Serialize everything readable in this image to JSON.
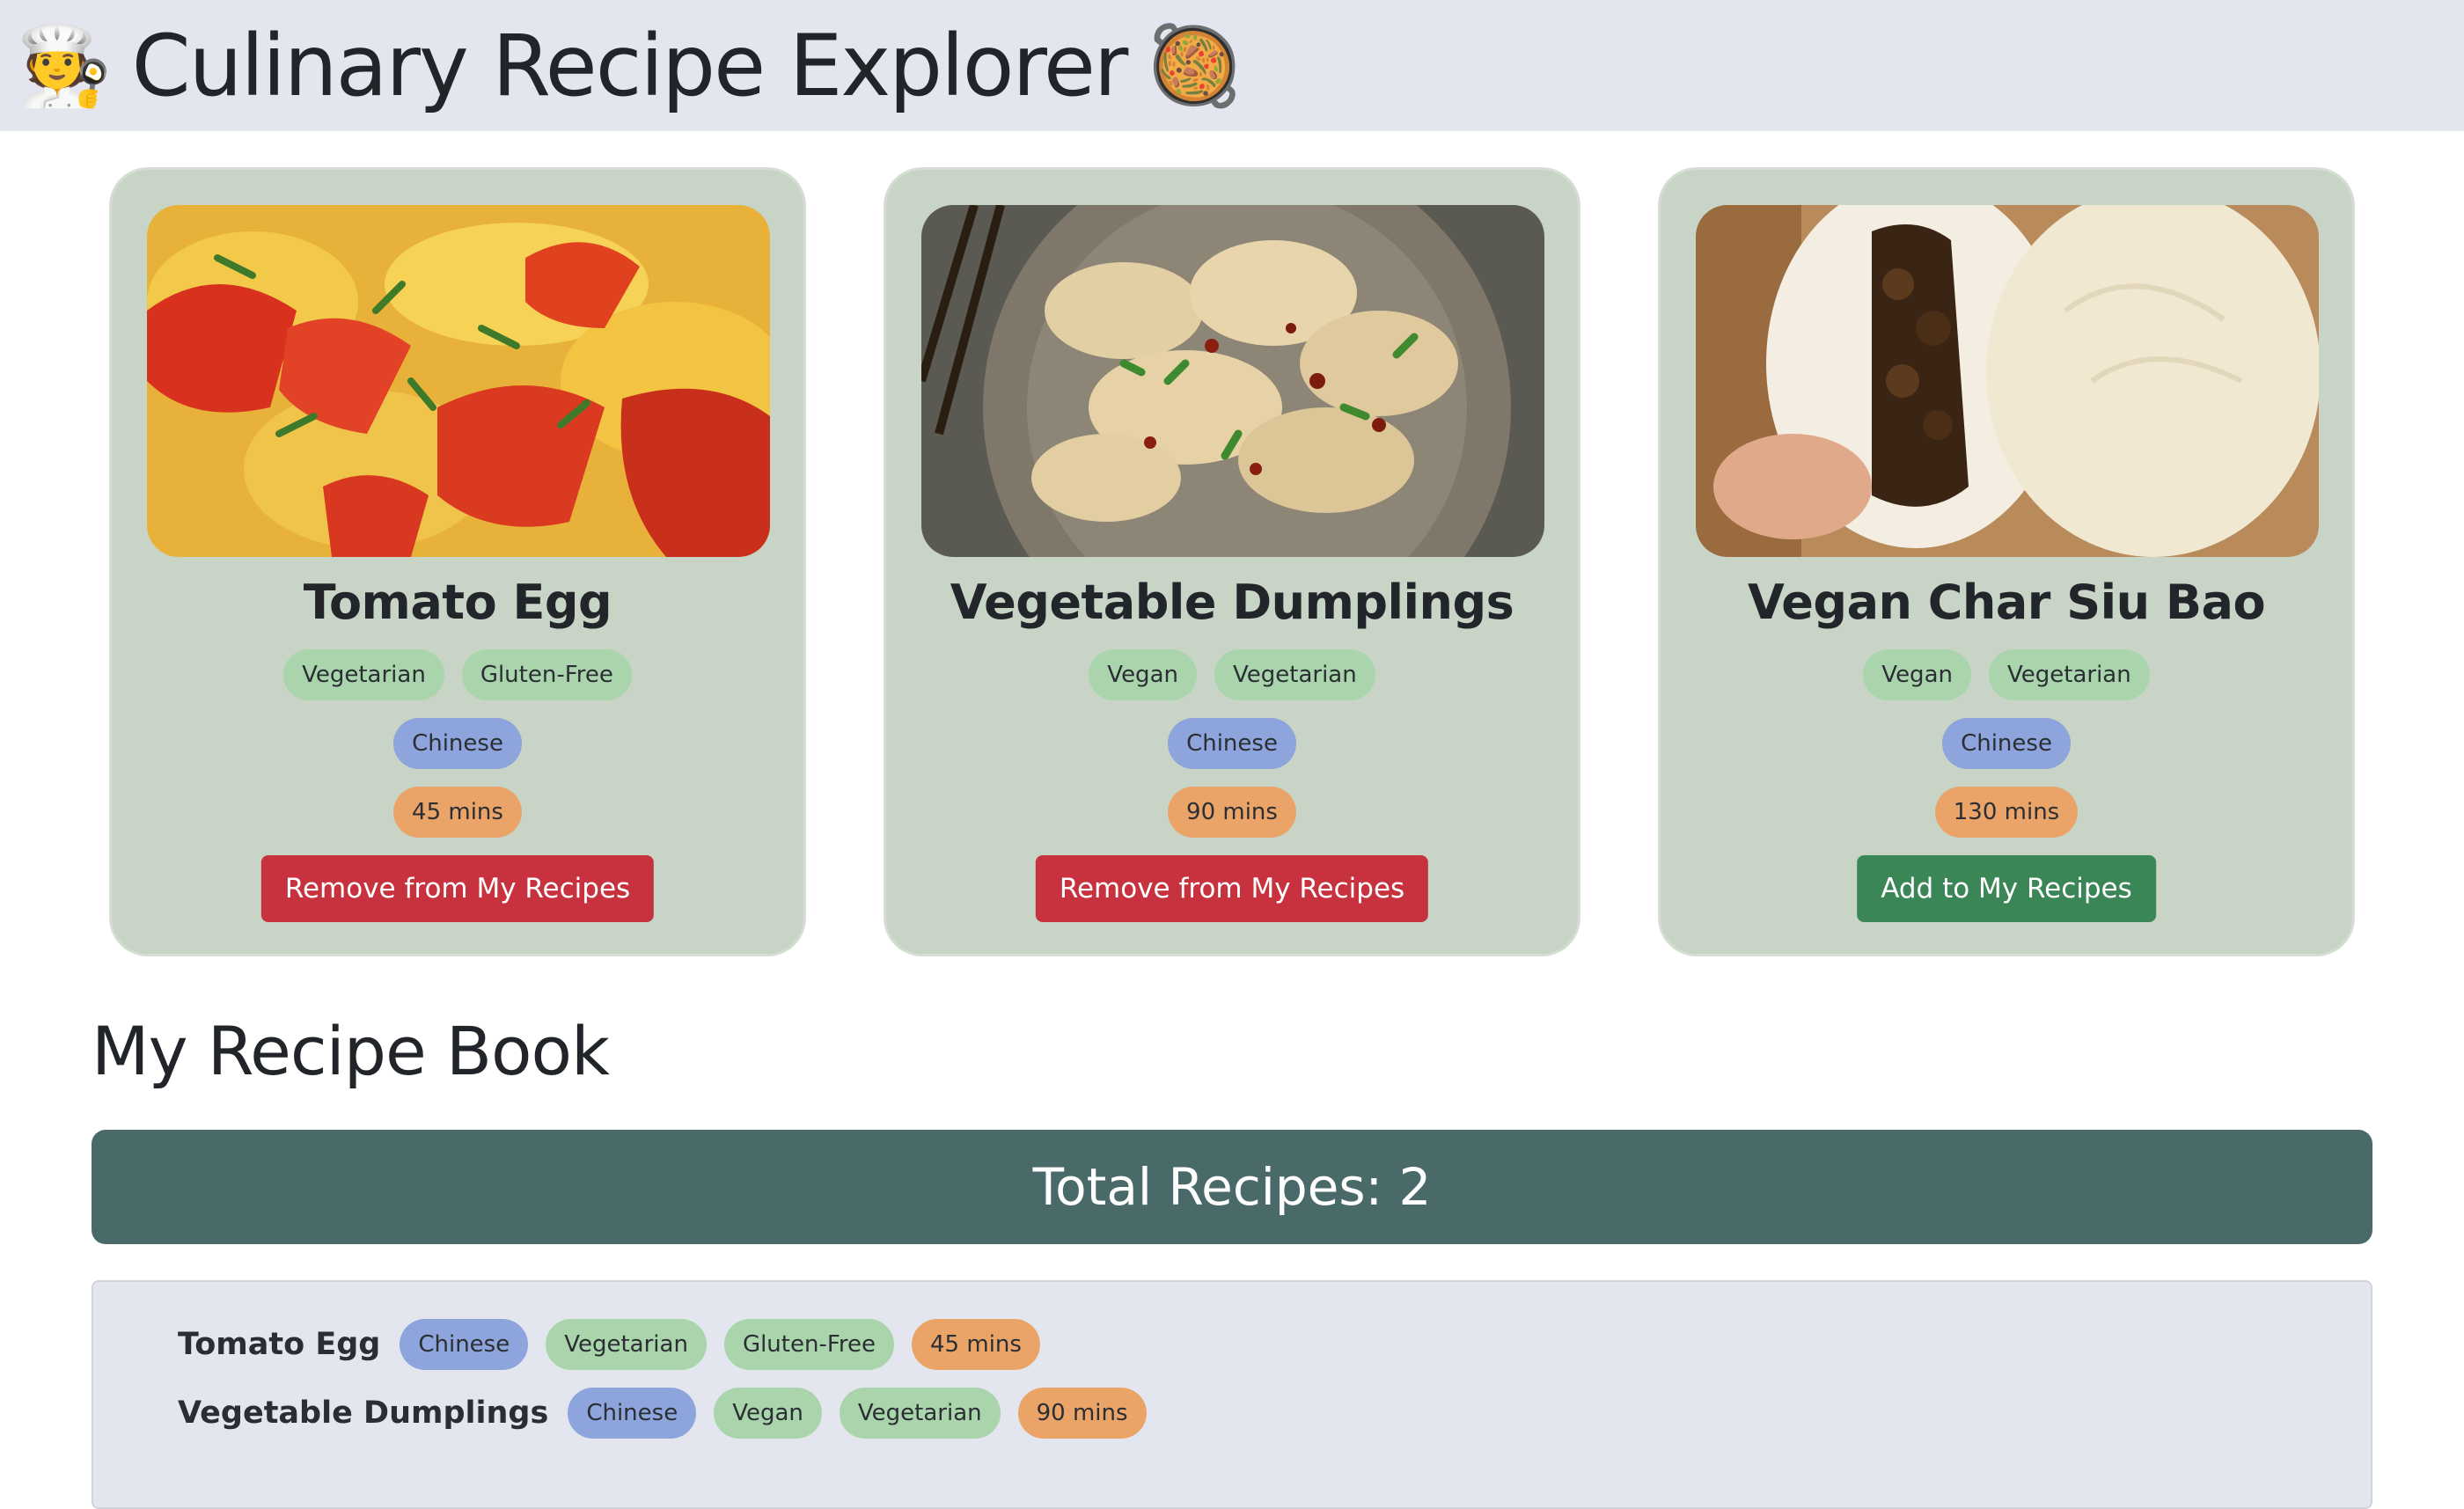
{
  "header": {
    "title": "Culinary Recipe Explorer",
    "icon_left": "chef-emoji",
    "icon_right": "paella-pan-emoji",
    "icon_left_glyph": "🧑‍🍳",
    "icon_right_glyph": "🥘"
  },
  "recipes": [
    {
      "title": "Tomato Egg",
      "image": "tomato-egg-stir-fry-photo",
      "tags": [
        "Vegetarian",
        "Gluten-Free"
      ],
      "cuisine": "Chinese",
      "time": "45 mins",
      "button": "Remove from My Recipes"
    },
    {
      "title": "Vegetable Dumplings",
      "image": "vegetable-dumplings-bowl-photo",
      "tags": [
        "Vegan",
        "Vegetarian"
      ],
      "cuisine": "Chinese",
      "time": "90 mins",
      "button": "Remove from My Recipes"
    },
    {
      "title": "Vegan Char Siu Bao",
      "image": "char-siu-bao-buns-photo",
      "tags": [
        "Vegan",
        "Vegetarian"
      ],
      "cuisine": "Chinese",
      "time": "130 mins",
      "button": "Add to My Recipes"
    }
  ],
  "book": {
    "title": "My Recipe Book",
    "total": "Total Recipes: 2",
    "items": [
      {
        "name": "Tomato Egg",
        "cuisine": "Chinese",
        "tags": [
          "Vegetarian",
          "Gluten-Free"
        ],
        "time": "45 mins"
      },
      {
        "name": "Vegetable Dumplings",
        "cuisine": "Chinese",
        "tags": [
          "Vegan",
          "Vegetarian"
        ],
        "time": "90 mins"
      }
    ]
  },
  "colors": {
    "header_bg": "#e3e6ee",
    "card_bg": "#c8d4c6",
    "diet_pill": "#a9d4ac",
    "cuisine_pill": "#8da4dc",
    "time_pill": "#eba468",
    "remove_button": "#c8323f",
    "add_button": "#3a8657",
    "total_bar": "#4a6a69"
  }
}
